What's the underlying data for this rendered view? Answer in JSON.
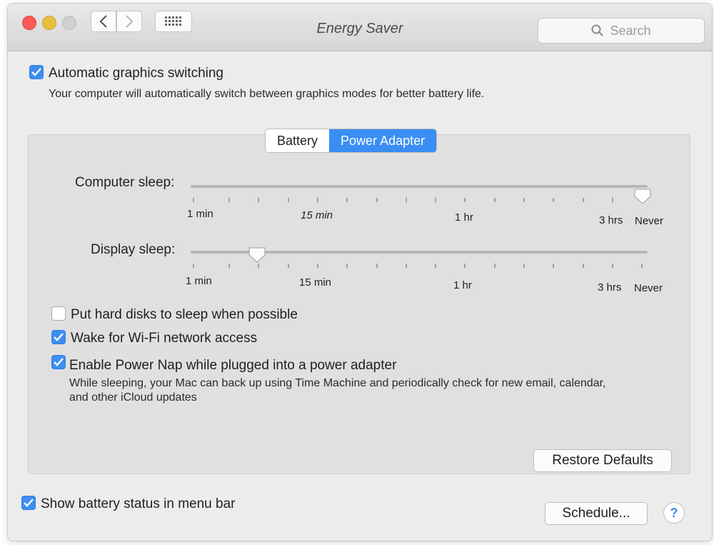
{
  "window": {
    "title": "Energy Saver",
    "search_placeholder": "Search"
  },
  "graphics": {
    "checked": true,
    "label": "Automatic graphics switching",
    "description": "Your computer will automatically switch between graphics modes for better battery life."
  },
  "tabs": [
    {
      "label": "Battery",
      "active": false
    },
    {
      "label": "Power Adapter",
      "active": true
    }
  ],
  "sliders": {
    "computer_sleep": {
      "label": "Computer sleep:",
      "value": "Never",
      "ticks": [
        "1 min",
        "15 min",
        "1 hr",
        "3 hrs",
        "Never"
      ]
    },
    "display_sleep": {
      "label": "Display sleep:",
      "value": "about 5 min",
      "ticks": [
        "1 min",
        "15 min",
        "1 hr",
        "3 hrs",
        "Never"
      ]
    }
  },
  "options": {
    "hard_disks": {
      "checked": false,
      "label": "Put hard disks to sleep when possible"
    },
    "wifi": {
      "checked": true,
      "label": "Wake for Wi-Fi network access"
    },
    "power_nap": {
      "checked": true,
      "label": "Enable Power Nap while plugged into a power adapter",
      "description": "While sleeping, your Mac can back up using Time Machine and periodically check for new email, calendar, and other iCloud updates"
    }
  },
  "buttons": {
    "restore_defaults": "Restore Defaults",
    "schedule": "Schedule...",
    "help": "?"
  },
  "battery_status": {
    "checked": true,
    "label": "Show battery status in menu bar"
  },
  "colors": {
    "accent": "#3d8ef0",
    "window_bg": "#ececec",
    "panel_bg": "#e0e0e0"
  }
}
